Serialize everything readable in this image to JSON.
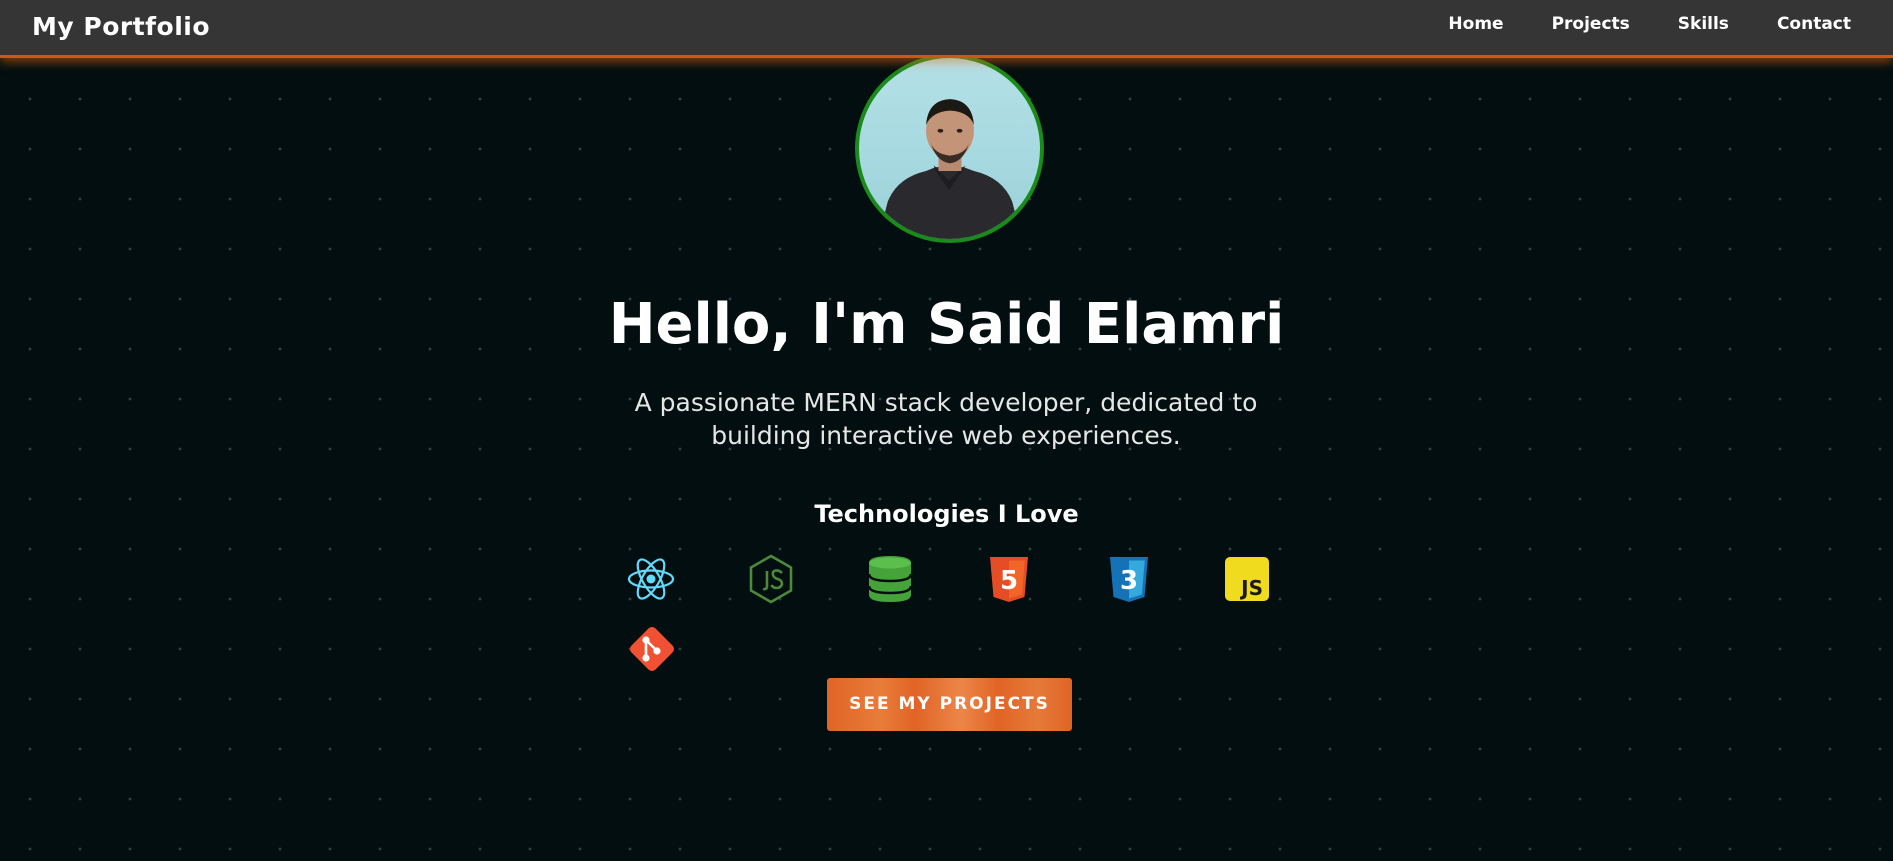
{
  "navbar": {
    "brand": "My Portfolio",
    "links": [
      "Home",
      "Projects",
      "Skills",
      "Contact"
    ]
  },
  "hero": {
    "title": "Hello, I'm Said Elamri",
    "subtitle": "A passionate MERN stack developer, dedicated to building interactive web experiences.",
    "avatar_icon": "profile-photo"
  },
  "technologies": {
    "heading": "Technologies I Love",
    "icons": [
      "react-icon",
      "nodejs-icon",
      "database-icon",
      "html5-icon",
      "css3-icon",
      "javascript-icon",
      "git-icon"
    ],
    "javascript_badge": "JS",
    "html_badge": "5",
    "css_badge": "3"
  },
  "cta": {
    "label": "SEE MY PROJECTS"
  },
  "colors": {
    "background": "#020e0f",
    "navbar": "#353535",
    "accent": "#e06426",
    "avatar_border": "#1a8a1a"
  }
}
